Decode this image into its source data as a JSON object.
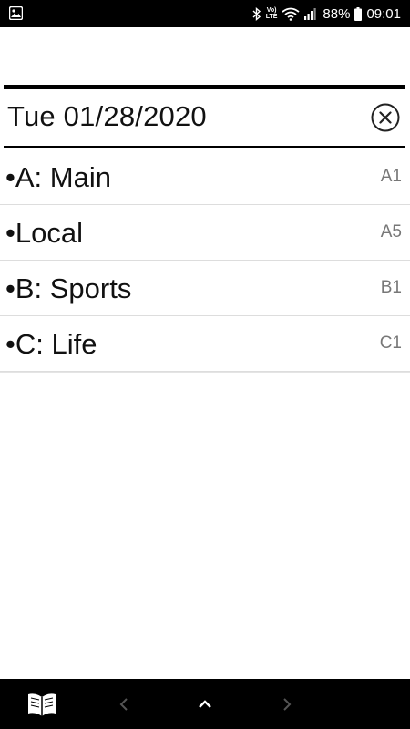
{
  "status_bar": {
    "volte_line1": "Vo)",
    "volte_line2": "LTE",
    "battery": "88%",
    "time": "09:01"
  },
  "header": {
    "date": "Tue 01/28/2020",
    "close_icon": "circle-x-icon"
  },
  "sections": [
    {
      "label": "•A: Main",
      "code": "A1"
    },
    {
      "label": "•Local",
      "code": "A5"
    },
    {
      "label": "•B: Sports",
      "code": "B1"
    },
    {
      "label": "•C: Life",
      "code": "C1"
    }
  ],
  "bottom_bar": {
    "book_icon": "open-book-icon",
    "prev_icon": "chevron-left-icon",
    "up_icon": "chevron-up-icon",
    "next_icon": "chevron-right-icon"
  },
  "colors": {
    "bar_background": "#000000",
    "text": "#111111",
    "code_text": "#777777",
    "disabled_chevron": "#555555"
  }
}
